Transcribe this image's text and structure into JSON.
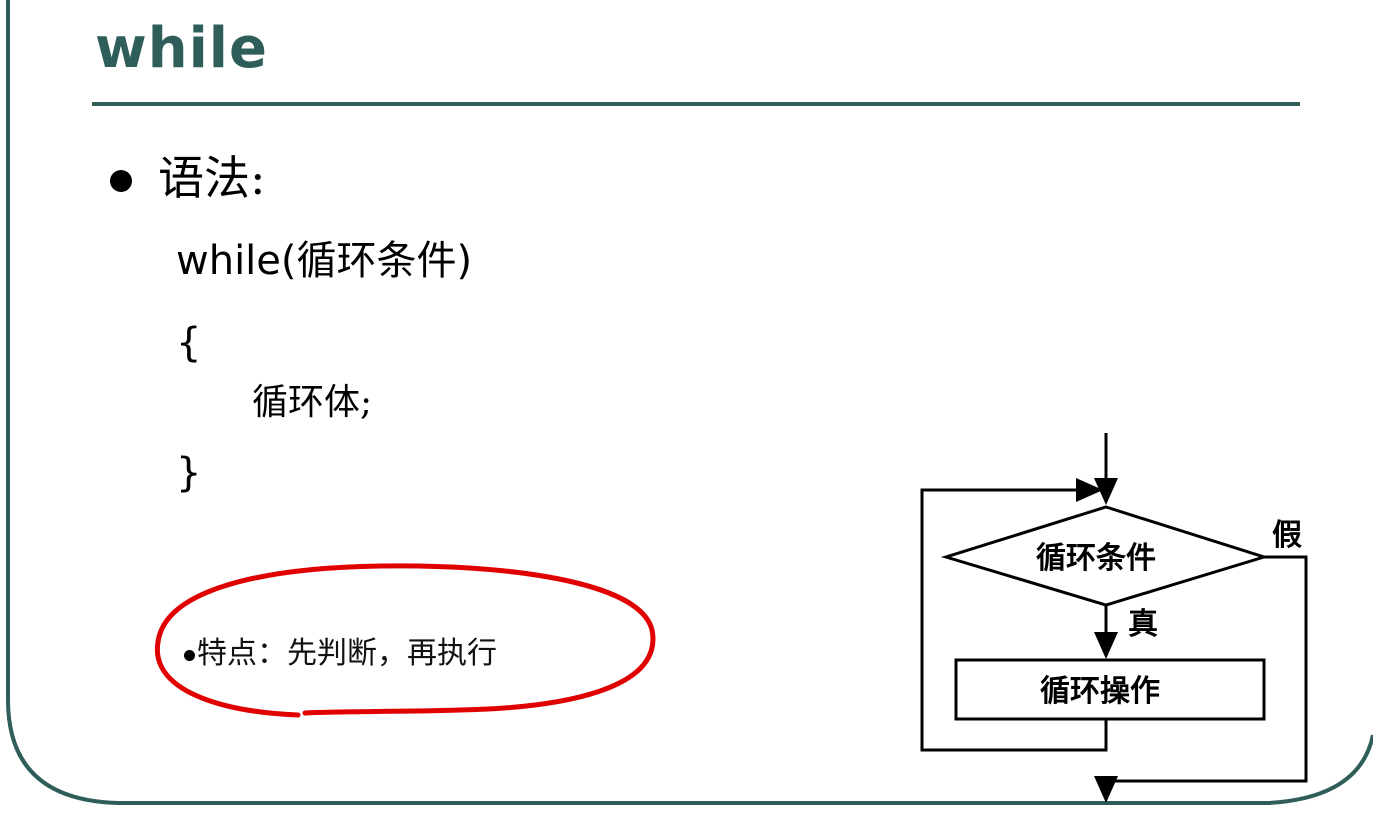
{
  "slide": {
    "title": "while",
    "bullet_heading": "语法:",
    "code_lines": [
      "while(循环条件)",
      "{",
      "循环体;",
      "}"
    ],
    "note": "特点：先判断，再执行",
    "accent_color": "#2e5d5a",
    "annotation_color": "#e00000"
  },
  "flowchart": {
    "condition_label": "循环条件",
    "true_label": "真",
    "false_label": "假",
    "action_label": "循环操作"
  }
}
